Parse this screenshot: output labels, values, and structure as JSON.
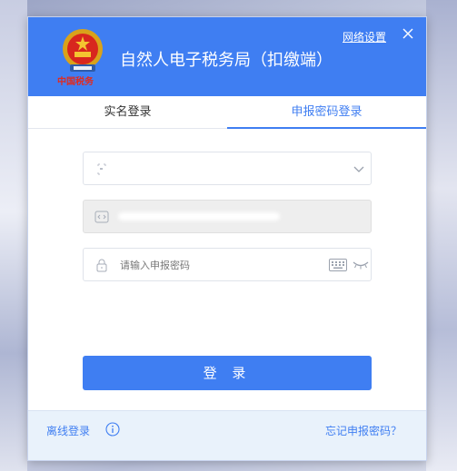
{
  "header": {
    "title": "自然人电子税务局（扣缴端）",
    "brand_text": "中国税务",
    "network_settings_label": "网络设置"
  },
  "tabs": [
    {
      "label": "实名登录",
      "active": false
    },
    {
      "label": "申报密码登录",
      "active": true
    }
  ],
  "form": {
    "account_value": "",
    "password_placeholder": "请输入申报密码"
  },
  "login_button_label": "登 录",
  "footer": {
    "offline_login_label": "离线登录",
    "forgot_password_label": "忘记申报密码？"
  },
  "colors": {
    "accent": "#3f7ef2",
    "header_bg": "#3f7ef2",
    "footer_bg": "#e9f2fb",
    "brand_red": "#e02b20"
  },
  "icons": [
    "national-emblem-icon",
    "close-icon",
    "user-selector-icon",
    "chevron-down-icon",
    "code-icon",
    "lock-icon",
    "keyboard-icon",
    "eye-closed-icon",
    "info-icon"
  ]
}
